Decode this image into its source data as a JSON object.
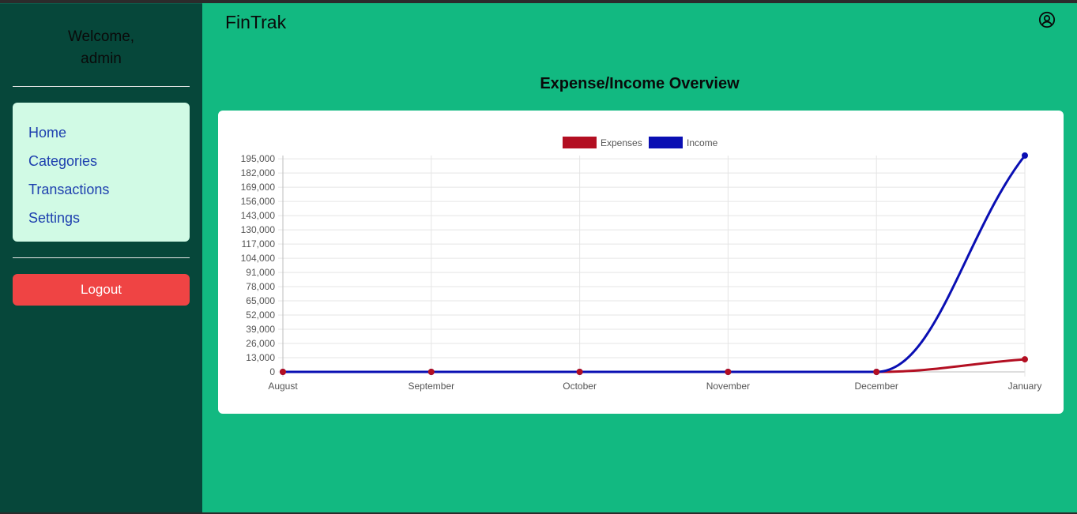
{
  "sidebar": {
    "welcome_line1": "Welcome,",
    "welcome_line2": "admin",
    "nav": [
      {
        "label": "Home"
      },
      {
        "label": "Categories"
      },
      {
        "label": "Transactions"
      },
      {
        "label": "Settings"
      }
    ],
    "logout_label": "Logout"
  },
  "header": {
    "brand": "FinTrak",
    "user_icon": "user-circle-icon"
  },
  "main": {
    "title": "Expense/Income Overview"
  },
  "colors": {
    "sidebar_bg": "#06473a",
    "main_bg": "#12b981",
    "nav_card_bg": "#d1fae5",
    "logout_bg": "#ef4444",
    "expenses": "#b30f22",
    "income": "#0a0fb3"
  },
  "chart_data": {
    "type": "line",
    "categories": [
      "August",
      "September",
      "October",
      "November",
      "December",
      "January"
    ],
    "series": [
      {
        "name": "Expenses",
        "color": "#b30f22",
        "values": [
          0,
          0,
          0,
          0,
          0,
          11500
        ]
      },
      {
        "name": "Income",
        "color": "#0a0fb3",
        "values": [
          0,
          0,
          0,
          0,
          0,
          198000
        ]
      }
    ],
    "yticks": [
      0,
      13000,
      26000,
      39000,
      52000,
      65000,
      78000,
      91000,
      104000,
      117000,
      130000,
      143000,
      156000,
      169000,
      182000,
      195000
    ],
    "ytick_labels": [
      "0",
      "13,000",
      "26,000",
      "39,000",
      "52,000",
      "65,000",
      "78,000",
      "91,000",
      "104,000",
      "117,000",
      "130,000",
      "143,000",
      "156,000",
      "169,000",
      "182,000",
      "195,000"
    ],
    "ylim": [
      0,
      198000
    ],
    "grid": true,
    "legend_position": "top-center",
    "title": "",
    "xlabel": "",
    "ylabel": ""
  }
}
